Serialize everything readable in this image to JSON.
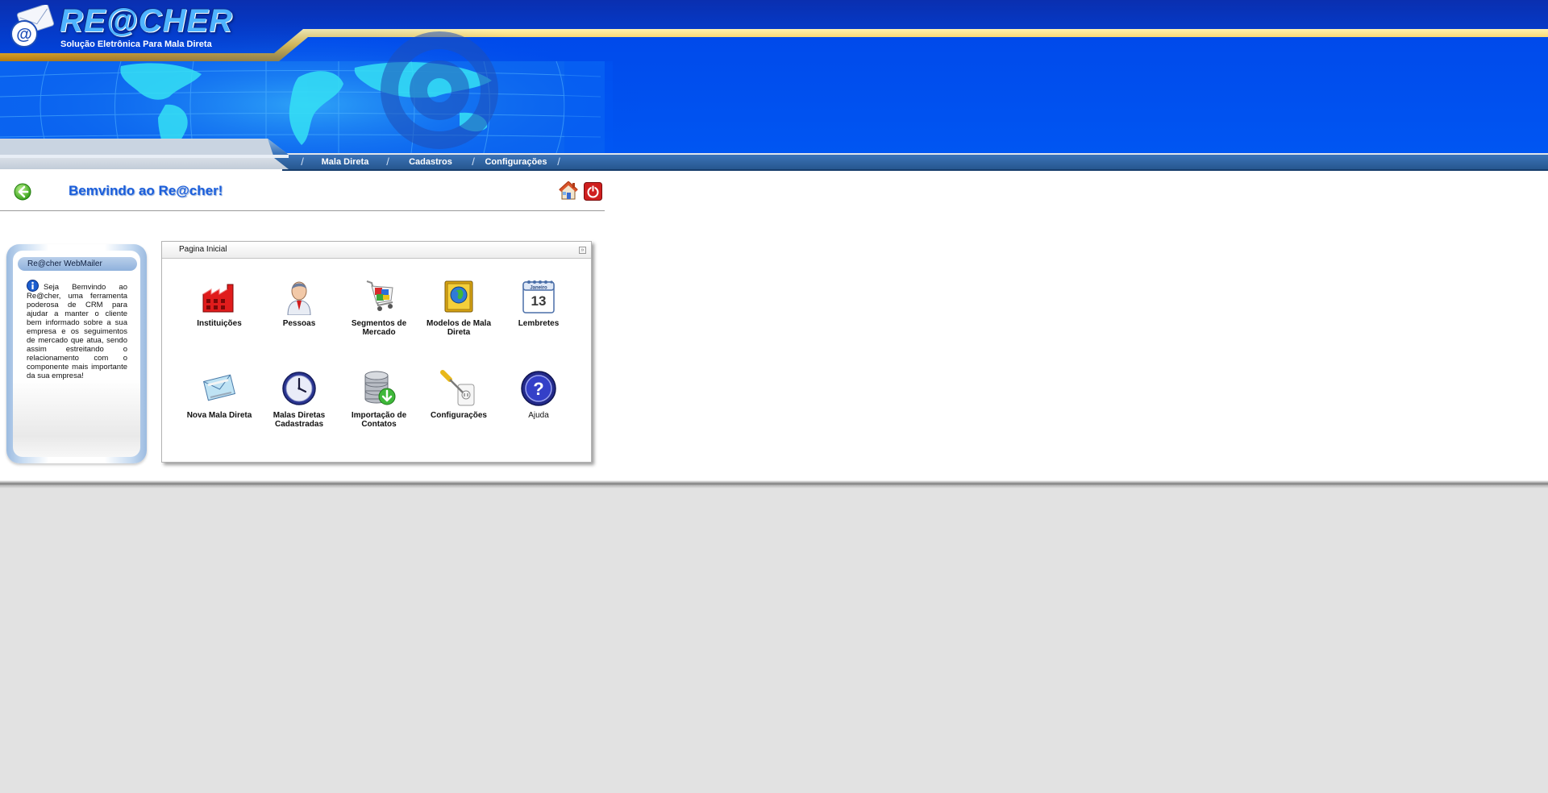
{
  "brand": {
    "name": "RE@CHER",
    "tagline": "Solução Eletrônica Para Mala Direta"
  },
  "nav": {
    "items": [
      {
        "label": "Mala Direta"
      },
      {
        "label": "Cadastros"
      },
      {
        "label": "Configurações"
      }
    ]
  },
  "page": {
    "welcome": "Bemvindo ao Re@cher!"
  },
  "side_panel": {
    "title": "Re@cher WebMailer",
    "text": "Seja Bemvindo ao Re@cher, uma ferramenta poderosa de CRM para ajudar a manter o cliente bem informado sobre a sua empresa e os seguimentos de mercado que atua, sendo assim estreitando o relacionamento com o componente mais importante da sua empresa!"
  },
  "main_panel": {
    "title": "Pagina Inicial",
    "collapse_symbol": "»",
    "tiles": [
      {
        "label": "Instituições",
        "icon": "factory-icon"
      },
      {
        "label": "Pessoas",
        "icon": "person-icon"
      },
      {
        "label": "Segmentos de Mercado",
        "icon": "shopping-cart-icon"
      },
      {
        "label": "Modelos de Mala Direta",
        "icon": "globe-book-icon"
      },
      {
        "label": "Lembretes",
        "icon": "calendar-icon",
        "calendar_month": "Janeiro",
        "calendar_day": "13"
      },
      {
        "label": "Nova Mala Direta",
        "icon": "envelope-icon"
      },
      {
        "label": "Malas Diretas Cadastradas",
        "icon": "clock-icon"
      },
      {
        "label": "Importação de Contatos",
        "icon": "database-import-icon"
      },
      {
        "label": "Configurações",
        "icon": "screwdriver-icon"
      },
      {
        "label": "Ajuda",
        "icon": "help-icon"
      }
    ]
  },
  "colors": {
    "banner_blue": "#0055f0",
    "accent_gold": "#f5c23a",
    "welcome_text": "#1b5edb",
    "page_background": "#e2e2e2"
  }
}
